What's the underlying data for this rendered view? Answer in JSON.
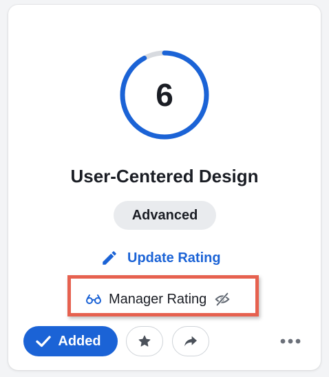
{
  "skill_card": {
    "rating_value": "6",
    "rating_progress": 0.92,
    "skill_name": "User-Centered Design",
    "level": "Advanced",
    "update_rating_label": "Update Rating",
    "manager_rating_label": "Manager Rating",
    "added_label": "Added"
  },
  "icons": {
    "update": "pencil-icon",
    "manager": "glasses-icon",
    "visibility": "eye-off-icon",
    "added": "check-icon",
    "favorite": "star-icon",
    "share": "share-arrow-icon",
    "more": "more-horizontal-icon"
  },
  "colors": {
    "accent": "#1b63d6",
    "ring_track": "#d7dadf",
    "highlight": "#e6614f"
  }
}
